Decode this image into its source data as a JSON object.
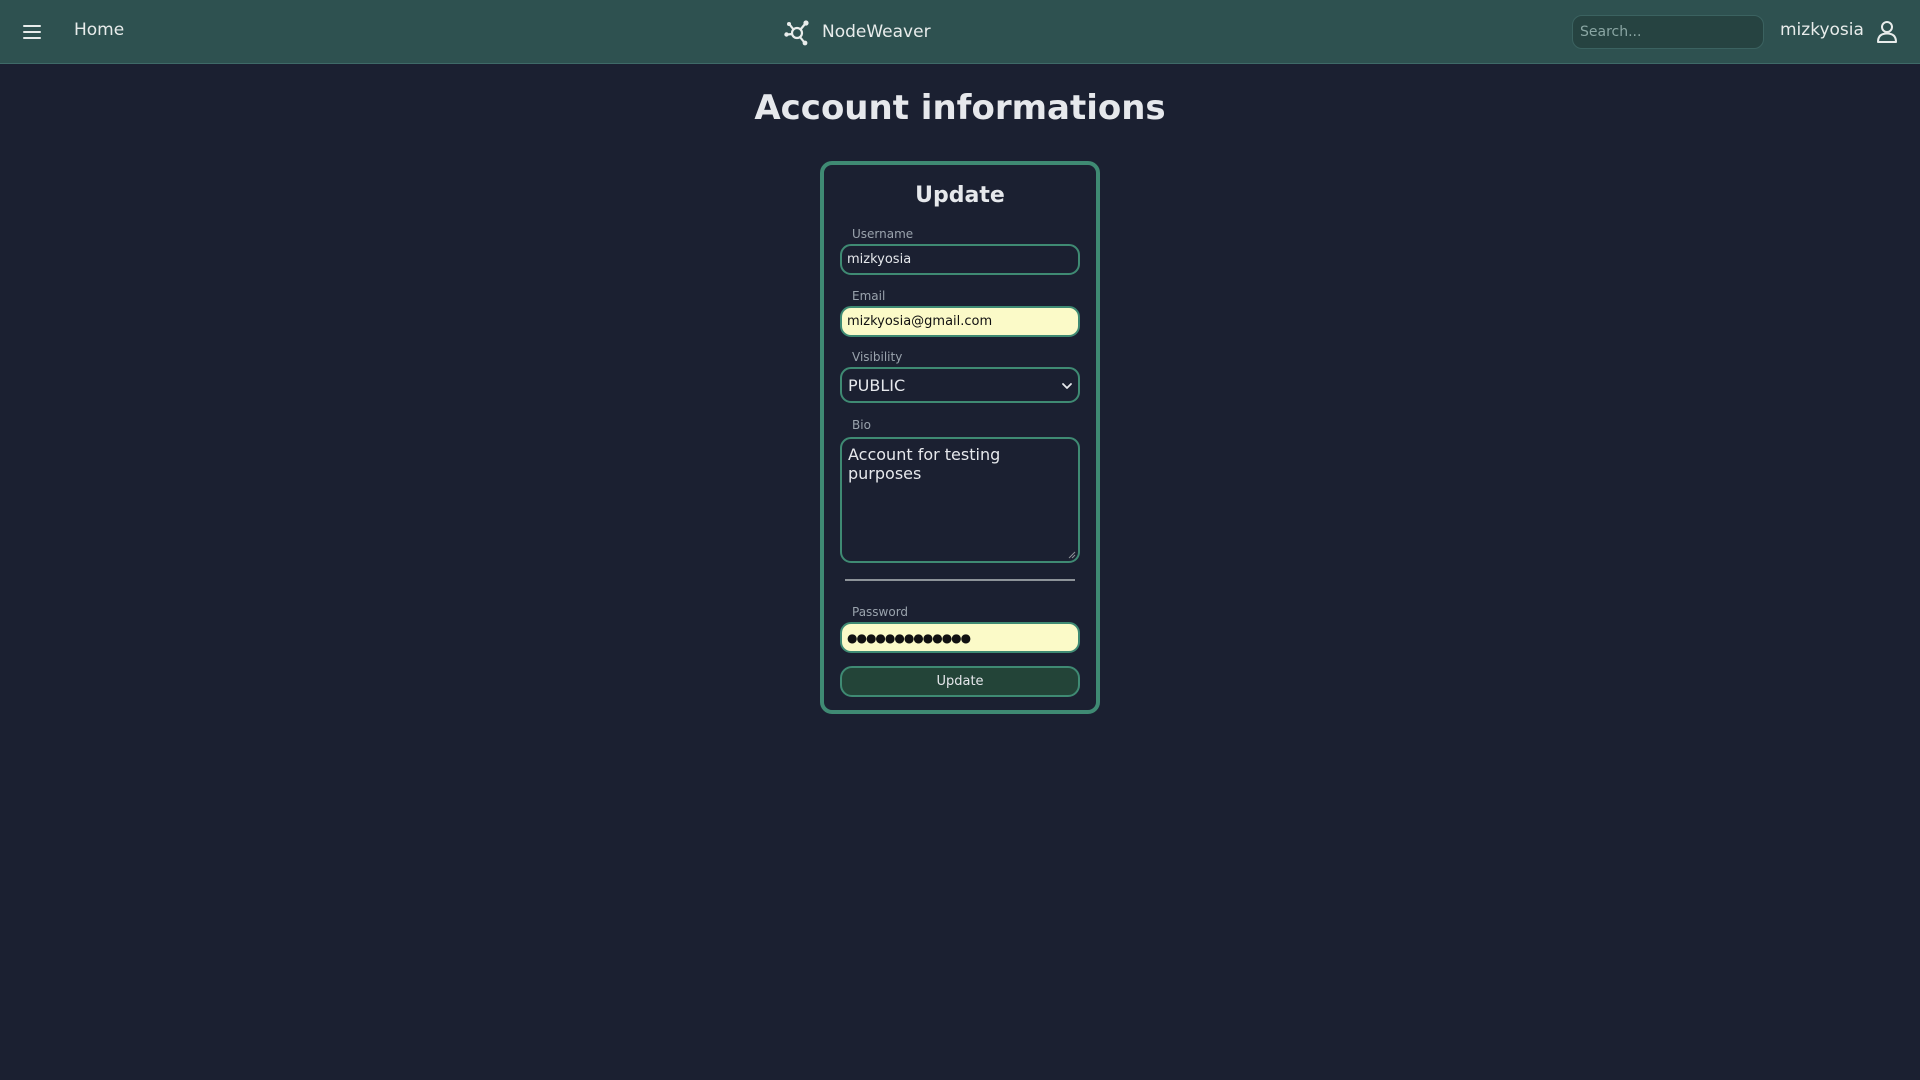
{
  "header": {
    "home_label": "Home",
    "brand_name": "NodeWeaver",
    "search_placeholder": "Search...",
    "user_name": "mizkyosia",
    "accent_color": "#2e5150"
  },
  "page": {
    "title": "Account informations"
  },
  "form": {
    "title": "Update",
    "username_label": "Username",
    "username_value": "mizkyosia",
    "email_label": "Email",
    "email_value": "mizkyosia@gmail.com",
    "visibility_label": "Visibility",
    "visibility_value": "PUBLIC",
    "bio_label": "Bio",
    "bio_value": "Account for testing purposes",
    "password_label": "Password",
    "password_value": "●●●●●●●●●●●●●",
    "submit_label": "Update",
    "border_color": "#3f8a73",
    "autofill_color": "#fbfac8"
  }
}
